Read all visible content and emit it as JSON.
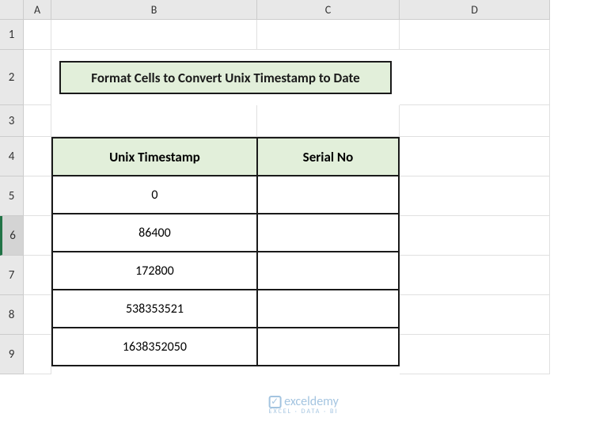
{
  "columns": [
    "A",
    "B",
    "C",
    "D"
  ],
  "rows": [
    "1",
    "2",
    "3",
    "4",
    "5",
    "6",
    "7",
    "8",
    "9"
  ],
  "selected_row": "6",
  "title": "Format Cells to Convert Unix Timestamp to Date",
  "table": {
    "headers": [
      "Unix Timestamp",
      "Serial No"
    ],
    "data": [
      [
        "0",
        ""
      ],
      [
        "86400",
        ""
      ],
      [
        "172800",
        ""
      ],
      [
        "538353521",
        ""
      ],
      [
        "1638352050",
        ""
      ]
    ]
  },
  "watermark": {
    "main": "exceldemy",
    "sub": "EXCEL · DATA · BI"
  },
  "chart_data": {
    "type": "table",
    "title": "Format Cells to Convert Unix Timestamp to Date",
    "columns": [
      "Unix Timestamp",
      "Serial No"
    ],
    "rows": [
      {
        "Unix Timestamp": 0,
        "Serial No": null
      },
      {
        "Unix Timestamp": 86400,
        "Serial No": null
      },
      {
        "Unix Timestamp": 172800,
        "Serial No": null
      },
      {
        "Unix Timestamp": 538353521,
        "Serial No": null
      },
      {
        "Unix Timestamp": 1638352050,
        "Serial No": null
      }
    ]
  }
}
